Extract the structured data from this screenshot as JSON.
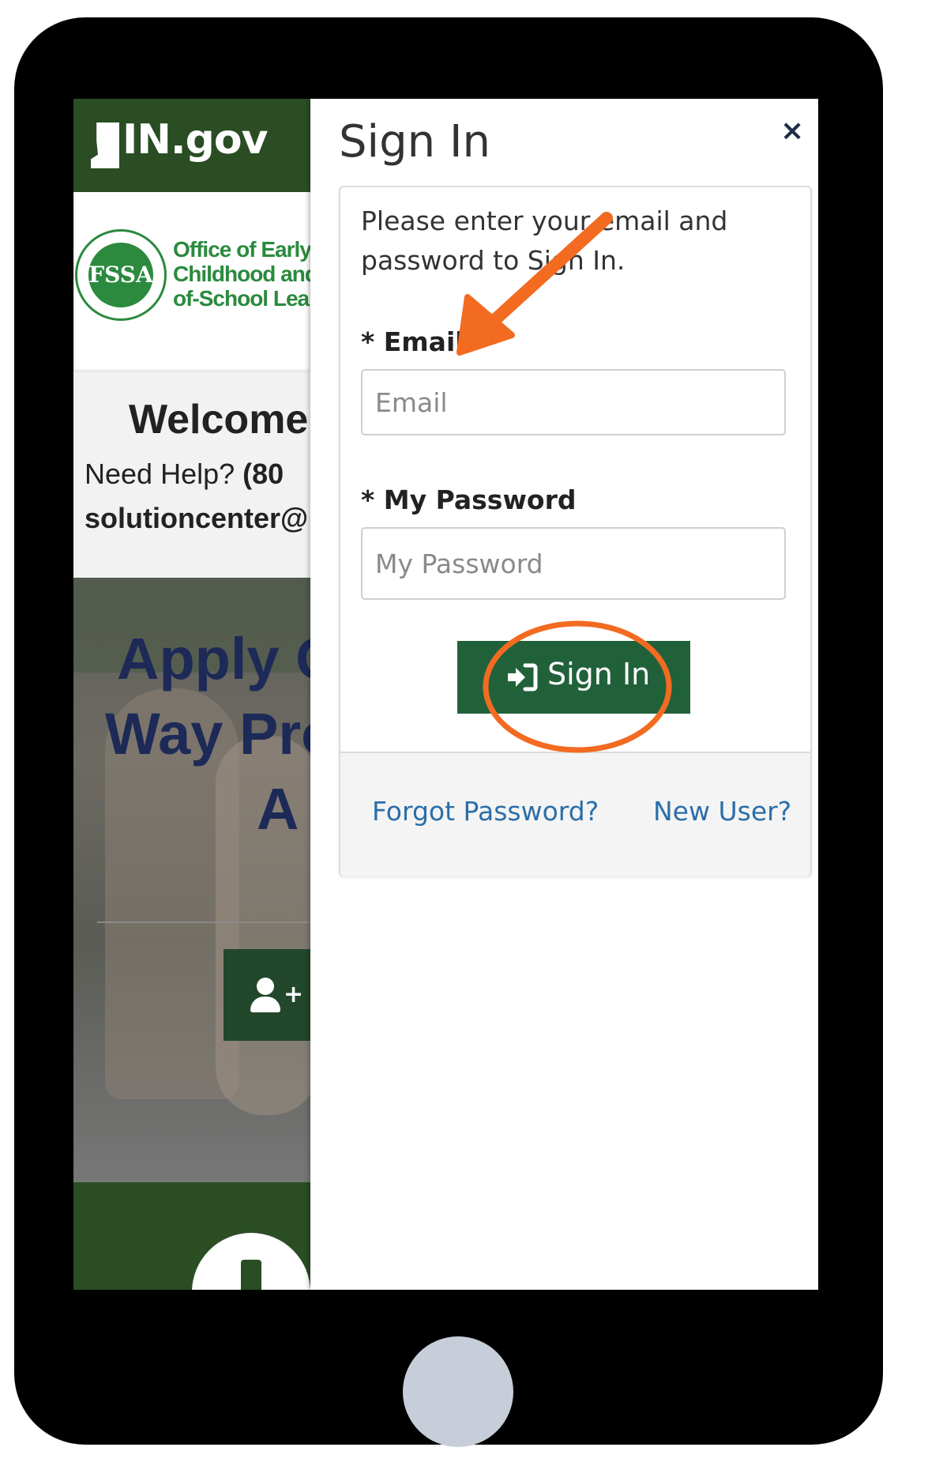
{
  "header": {
    "logo_text": "IN.gov",
    "logo_suffix_text": ""
  },
  "agency": {
    "seal_text": "FSSA",
    "name_lines": [
      "Office of Early",
      "Childhood and Out-",
      "of-School Learning"
    ]
  },
  "background_page": {
    "welcome": "Welcome",
    "help_prefix": "Need Help?",
    "help_phone": "(80",
    "help_email": "solutioncenter@",
    "hero_line1": "Apply O",
    "hero_line2": "Way Pro",
    "hero_line3": "A"
  },
  "signin": {
    "title": "Sign In",
    "close_symbol": "×",
    "intro": "Please enter your email and password to Sign In.",
    "email_label": "* Email",
    "email_placeholder": "Email",
    "password_label": "* My Password",
    "password_placeholder": "My Password",
    "submit_label": "Sign In",
    "forgot_password": "Forgot Password?",
    "new_user": "New User?"
  },
  "colors": {
    "brand_green": "#2a4d24",
    "button_green": "#21613a",
    "link_blue": "#2b6ea8",
    "annotation_orange": "#f26b21"
  },
  "icons": [
    "sign-in-icon",
    "add-user-icon",
    "close-icon",
    "alert-icon",
    "arrow-annotation",
    "circle-annotation"
  ]
}
